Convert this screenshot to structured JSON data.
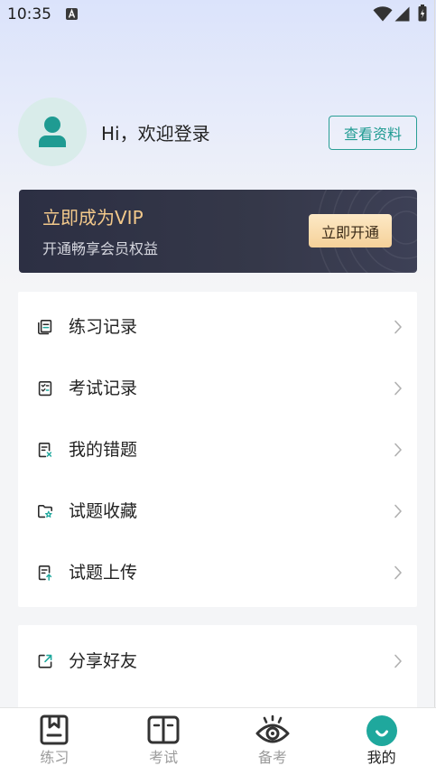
{
  "status_bar": {
    "time": "10:35",
    "icons": [
      "notification-a-icon",
      "wifi-icon",
      "signal-icon",
      "battery-charging-icon"
    ]
  },
  "profile": {
    "avatar_icon": "person-icon",
    "greeting": "Hi，欢迎登录",
    "view_profile_button": "查看资料"
  },
  "vip_banner": {
    "title": "立即成为VIP",
    "subtitle": "开通畅享会员权益",
    "button": "立即开通"
  },
  "menu_groups": [
    {
      "items": [
        {
          "label": "练习记录",
          "icon": "practice-record-icon"
        },
        {
          "label": "考试记录",
          "icon": "exam-record-icon"
        },
        {
          "label": "我的错题",
          "icon": "wrong-questions-icon"
        },
        {
          "label": "试题收藏",
          "icon": "favorites-folder-icon"
        },
        {
          "label": "试题上传",
          "icon": "upload-question-icon"
        }
      ]
    },
    {
      "items": [
        {
          "label": "分享好友",
          "icon": "share-icon"
        }
      ]
    }
  ],
  "tab_bar": {
    "tabs": [
      {
        "label": "练习",
        "icon": "practice-book-icon",
        "active": false
      },
      {
        "label": "考试",
        "icon": "exam-book-icon",
        "active": false
      },
      {
        "label": "备考",
        "icon": "eye-icon",
        "active": false
      },
      {
        "label": "我的",
        "icon": "smile-circle-icon",
        "active": true
      }
    ]
  },
  "colors": {
    "accent": "#1f9b92",
    "vip_card": "#2f3246",
    "vip_gold": "#f3c98b",
    "vip_button": "#f8dcaa",
    "background_top": "#dbe3fb",
    "background": "#f4f5f7"
  }
}
